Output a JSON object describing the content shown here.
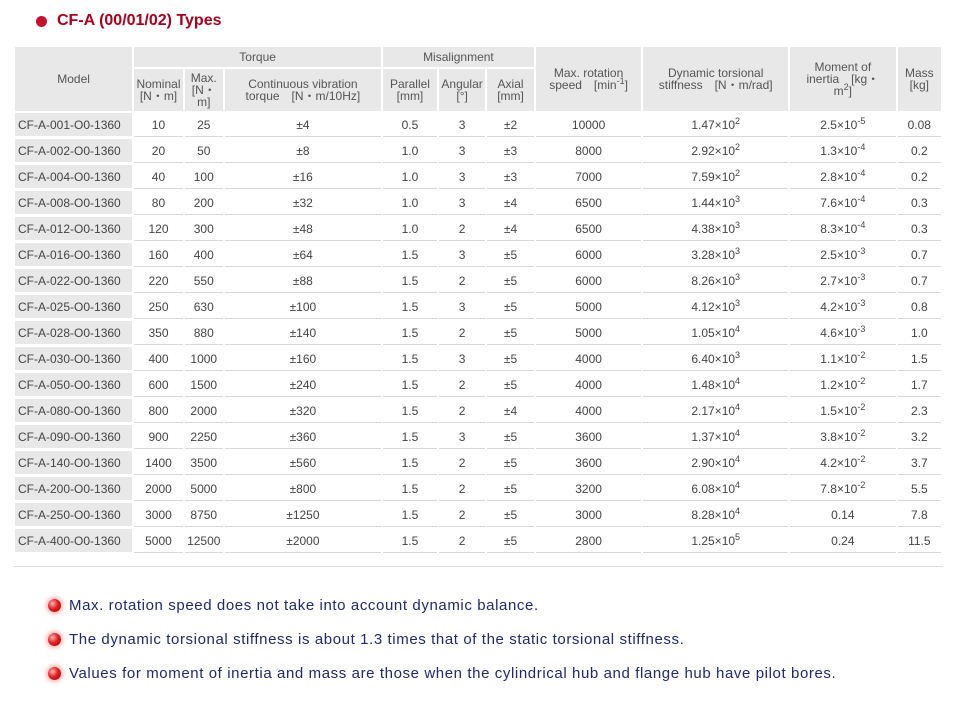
{
  "title": "CF-A (00/01/02) Types",
  "headers": {
    "model": "Model",
    "torque": "Torque",
    "misalignment": "Misalignment",
    "nominal": "Nominal",
    "nominal_unit": "[N・m]",
    "max": "Max.",
    "max_unit": "[N・m]",
    "cont_vib": "Continuous vibration",
    "cont_vib_unit": "torque　[N・m/10Hz]",
    "parallel": "Parallel",
    "parallel_unit": "[mm]",
    "angular": "Angular",
    "angular_unit": "[°]",
    "axial": "Axial",
    "axial_unit": "[mm]",
    "max_rot": "Max. rotation",
    "max_rot_unit": "speed　[min",
    "max_rot_exp": "-1",
    "dyn_tor": "Dynamic torsional",
    "dyn_tor_unit": "stiffness　[N・m/rad]",
    "moi": "Moment of",
    "moi_unit": "inertia　[kg・",
    "moi_unit2": "m",
    "moi_exp": "2",
    "mass": "Mass",
    "mass_unit": "[kg]"
  },
  "rows": [
    {
      "model": "CF-A-001-O0-1360",
      "nominal": "10",
      "max": "25",
      "cont": "±4",
      "parallel": "0.5",
      "angular": "3",
      "axial": "±2",
      "speed": "10000",
      "stiff_base": "1.47×10",
      "stiff_exp": "2",
      "moi_base": "2.5×10",
      "moi_exp": "-5",
      "mass": "0.08"
    },
    {
      "model": "CF-A-002-O0-1360",
      "nominal": "20",
      "max": "50",
      "cont": "±8",
      "parallel": "1.0",
      "angular": "3",
      "axial": "±3",
      "speed": "8000",
      "stiff_base": "2.92×10",
      "stiff_exp": "2",
      "moi_base": "1.3×10",
      "moi_exp": "-4",
      "mass": "0.2"
    },
    {
      "model": "CF-A-004-O0-1360",
      "nominal": "40",
      "max": "100",
      "cont": "±16",
      "parallel": "1.0",
      "angular": "3",
      "axial": "±3",
      "speed": "7000",
      "stiff_base": "7.59×10",
      "stiff_exp": "2",
      "moi_base": "2.8×10",
      "moi_exp": "-4",
      "mass": "0.2"
    },
    {
      "model": "CF-A-008-O0-1360",
      "nominal": "80",
      "max": "200",
      "cont": "±32",
      "parallel": "1.0",
      "angular": "3",
      "axial": "±4",
      "speed": "6500",
      "stiff_base": "1.44×10",
      "stiff_exp": "3",
      "moi_base": "7.6×10",
      "moi_exp": "-4",
      "mass": "0.3"
    },
    {
      "model": "CF-A-012-O0-1360",
      "nominal": "120",
      "max": "300",
      "cont": "±48",
      "parallel": "1.0",
      "angular": "2",
      "axial": "±4",
      "speed": "6500",
      "stiff_base": "4.38×10",
      "stiff_exp": "3",
      "moi_base": "8.3×10",
      "moi_exp": "-4",
      "mass": "0.3"
    },
    {
      "model": "CF-A-016-O0-1360",
      "nominal": "160",
      "max": "400",
      "cont": "±64",
      "parallel": "1.5",
      "angular": "3",
      "axial": "±5",
      "speed": "6000",
      "stiff_base": "3.28×10",
      "stiff_exp": "3",
      "moi_base": "2.5×10",
      "moi_exp": "-3",
      "mass": "0.7"
    },
    {
      "model": "CF-A-022-O0-1360",
      "nominal": "220",
      "max": "550",
      "cont": "±88",
      "parallel": "1.5",
      "angular": "2",
      "axial": "±5",
      "speed": "6000",
      "stiff_base": "8.26×10",
      "stiff_exp": "3",
      "moi_base": "2.7×10",
      "moi_exp": "-3",
      "mass": "0.7"
    },
    {
      "model": "CF-A-025-O0-1360",
      "nominal": "250",
      "max": "630",
      "cont": "±100",
      "parallel": "1.5",
      "angular": "3",
      "axial": "±5",
      "speed": "5000",
      "stiff_base": "4.12×10",
      "stiff_exp": "3",
      "moi_base": "4.2×10",
      "moi_exp": "-3",
      "mass": "0.8"
    },
    {
      "model": "CF-A-028-O0-1360",
      "nominal": "350",
      "max": "880",
      "cont": "±140",
      "parallel": "1.5",
      "angular": "2",
      "axial": "±5",
      "speed": "5000",
      "stiff_base": "1.05×10",
      "stiff_exp": "4",
      "moi_base": "4.6×10",
      "moi_exp": "-3",
      "mass": "1.0"
    },
    {
      "model": "CF-A-030-O0-1360",
      "nominal": "400",
      "max": "1000",
      "cont": "±160",
      "parallel": "1.5",
      "angular": "3",
      "axial": "±5",
      "speed": "4000",
      "stiff_base": "6.40×10",
      "stiff_exp": "3",
      "moi_base": "1.1×10",
      "moi_exp": "-2",
      "mass": "1.5"
    },
    {
      "model": "CF-A-050-O0-1360",
      "nominal": "600",
      "max": "1500",
      "cont": "±240",
      "parallel": "1.5",
      "angular": "2",
      "axial": "±5",
      "speed": "4000",
      "stiff_base": "1.48×10",
      "stiff_exp": "4",
      "moi_base": "1.2×10",
      "moi_exp": "-2",
      "mass": "1.7"
    },
    {
      "model": "CF-A-080-O0-1360",
      "nominal": "800",
      "max": "2000",
      "cont": "±320",
      "parallel": "1.5",
      "angular": "2",
      "axial": "±4",
      "speed": "4000",
      "stiff_base": "2.17×10",
      "stiff_exp": "4",
      "moi_base": "1.5×10",
      "moi_exp": "-2",
      "mass": "2.3"
    },
    {
      "model": "CF-A-090-O0-1360",
      "nominal": "900",
      "max": "2250",
      "cont": "±360",
      "parallel": "1.5",
      "angular": "3",
      "axial": "±5",
      "speed": "3600",
      "stiff_base": "1.37×10",
      "stiff_exp": "4",
      "moi_base": "3.8×10",
      "moi_exp": "-2",
      "mass": "3.2"
    },
    {
      "model": "CF-A-140-O0-1360",
      "nominal": "1400",
      "max": "3500",
      "cont": "±560",
      "parallel": "1.5",
      "angular": "2",
      "axial": "±5",
      "speed": "3600",
      "stiff_base": "2.90×10",
      "stiff_exp": "4",
      "moi_base": "4.2×10",
      "moi_exp": "-2",
      "mass": "3.7"
    },
    {
      "model": "CF-A-200-O0-1360",
      "nominal": "2000",
      "max": "5000",
      "cont": "±800",
      "parallel": "1.5",
      "angular": "2",
      "axial": "±5",
      "speed": "3200",
      "stiff_base": "6.08×10",
      "stiff_exp": "4",
      "moi_base": "7.8×10",
      "moi_exp": "-2",
      "mass": "5.5"
    },
    {
      "model": "CF-A-250-O0-1360",
      "nominal": "3000",
      "max": "8750",
      "cont": "±1250",
      "parallel": "1.5",
      "angular": "2",
      "axial": "±5",
      "speed": "3000",
      "stiff_base": "8.28×10",
      "stiff_exp": "4",
      "moi_base": "0.14",
      "moi_exp": "",
      "mass": "7.8"
    },
    {
      "model": "CF-A-400-O0-1360",
      "nominal": "5000",
      "max": "12500",
      "cont": "±2000",
      "parallel": "1.5",
      "angular": "2",
      "axial": "±5",
      "speed": "2800",
      "stiff_base": "1.25×10",
      "stiff_exp": "5",
      "moi_base": "0.24",
      "moi_exp": "",
      "mass": "11.5"
    }
  ],
  "notes": [
    "Max. rotation speed does not take into account dynamic balance.",
    "The dynamic torsional stiffness is about 1.3 times that of the static torsional stiffness.",
    "Values for moment of inertia and mass are those when the cylindrical hub and flange hub have pilot bores."
  ],
  "colors": {
    "title": "#a8001c",
    "header_bg": "#e8e8e8",
    "note_text": "#1f2a6b",
    "bullet": "#e02020"
  }
}
